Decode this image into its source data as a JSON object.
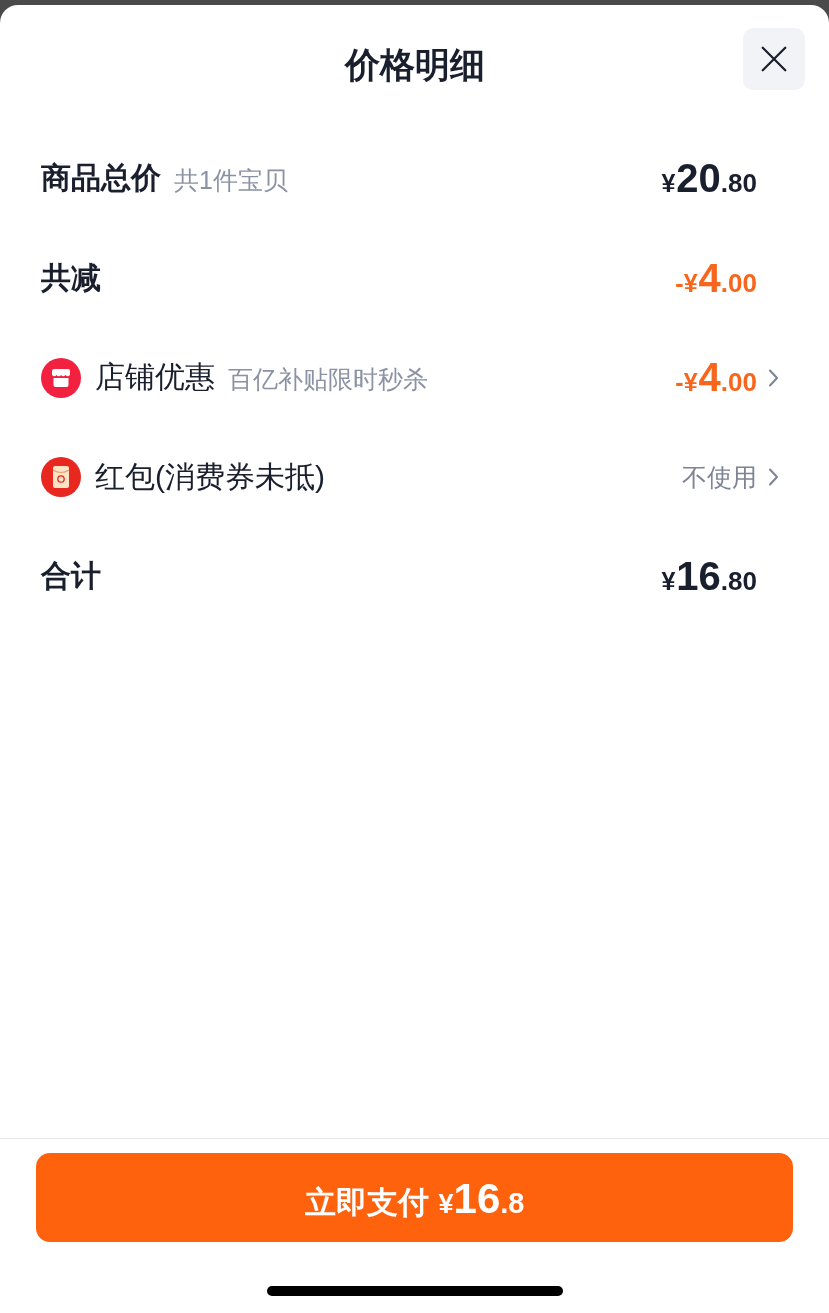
{
  "sheet": {
    "title": "价格明细"
  },
  "rows": [
    {
      "kind": "plain",
      "label": "商品总价",
      "note": "共1件宝贝",
      "price": {
        "prefix": "¥",
        "integer": "20",
        "decimal": ".80",
        "negative": false
      },
      "chevron": false
    },
    {
      "kind": "plain",
      "label": "共减",
      "price": {
        "prefix": "-¥",
        "integer": "4",
        "decimal": ".00",
        "negative": true
      },
      "chevron": false
    },
    {
      "kind": "store",
      "label": "店铺优惠",
      "note": "百亿补贴限时秒杀",
      "price": {
        "prefix": "-¥",
        "integer": "4",
        "decimal": ".00",
        "negative": true
      },
      "chevron": true
    },
    {
      "kind": "envelope",
      "label": "红包(消费券未抵)",
      "value": "不使用",
      "chevron": true
    },
    {
      "kind": "plain",
      "label": "合计",
      "price": {
        "prefix": "¥",
        "integer": "16",
        "decimal": ".80",
        "negative": false
      },
      "chevron": false
    }
  ],
  "pay_button": {
    "label": "立即支付",
    "price": {
      "prefix": "¥",
      "integer": "16",
      "decimal": ".8"
    }
  }
}
